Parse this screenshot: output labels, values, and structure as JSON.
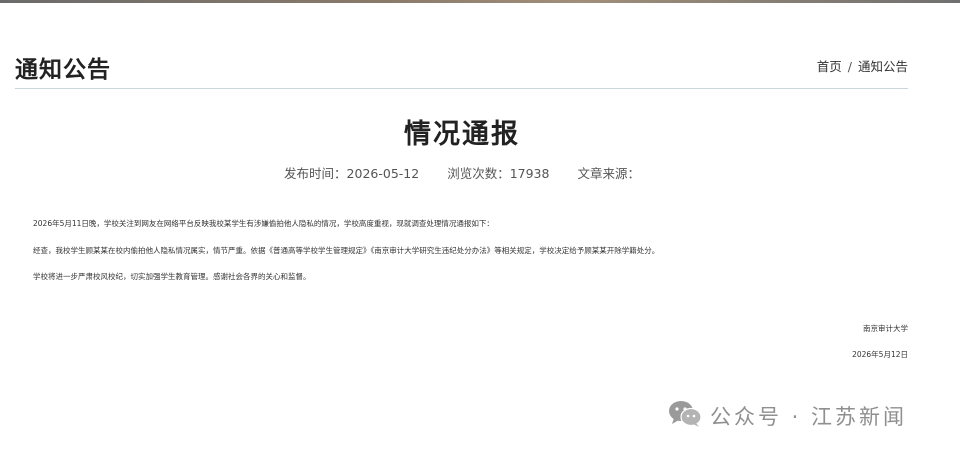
{
  "header": {
    "title": "通知公告",
    "breadcrumb": {
      "home": "首页",
      "separator": "/",
      "current": "通知公告"
    }
  },
  "article": {
    "title": "情况通报",
    "meta": {
      "publish_time": "发布时间：2026-05-12",
      "views": "浏览次数：17938",
      "source": "文章来源："
    },
    "paragraphs": [
      "2026年5月11日晚，学校关注到网友在网络平台反映我校某学生有涉嫌偷拍他人隐私的情况，学校高度重视，现就调查处理情况通报如下：",
      "经查，我校学生顾某某在校内偷拍他人隐私情况属实，情节严重。依据《普通高等学校学生管理规定》《南京审计大学研究生违纪处分办法》等相关规定，学校决定给予顾某某开除学籍处分。",
      "学校将进一步严肃校风校纪，切实加强学生教育管理。感谢社会各界的关心和监督。"
    ],
    "signature": {
      "org": "南京审计大学",
      "date": "2026年5月12日"
    }
  },
  "watermark": {
    "text": "公众号 · 江苏新闻",
    "icon": "wechat-icon"
  },
  "colors": {
    "divider": "#c9d6de",
    "title": "#222222",
    "meta": "#555555",
    "watermark": "#8f8f8f"
  }
}
